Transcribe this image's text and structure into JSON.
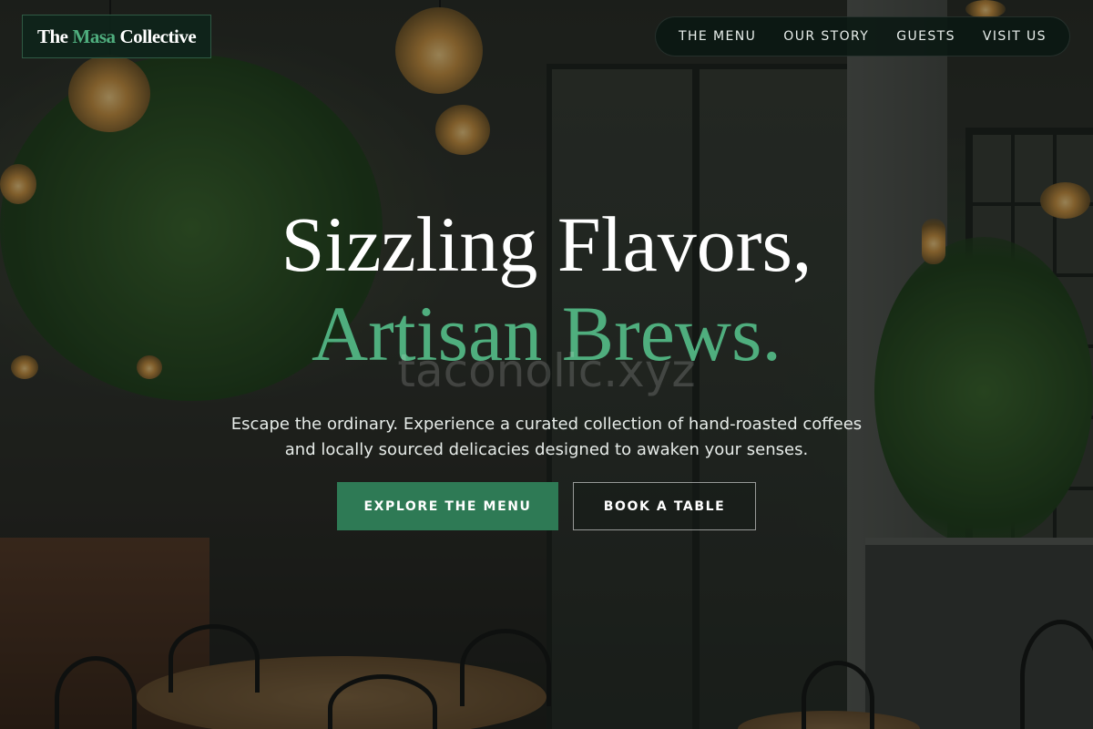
{
  "brand": {
    "word1": "The",
    "word2": "Masa",
    "word3": "Collective",
    "accent_color": "#4fae7e",
    "box_color": "#0e241a"
  },
  "nav": {
    "items": [
      {
        "label": "THE MENU"
      },
      {
        "label": "OUR STORY"
      },
      {
        "label": "GUESTS"
      },
      {
        "label": "VISIT US"
      }
    ]
  },
  "hero": {
    "headline_line1": "Sizzling Flavors,",
    "headline_line2": "Artisan Brews.",
    "watermark": "taconolic.xyz",
    "subtitle": "Escape the ordinary. Experience a curated collection of hand-roasted coffees and locally sourced delicacies designed to awaken your senses.",
    "primary_cta": "EXPLORE THE MENU",
    "secondary_cta": "BOOK A TABLE",
    "primary_color": "#2e7a55"
  },
  "background": {
    "description_icon": "restaurant-terrace-photo"
  }
}
